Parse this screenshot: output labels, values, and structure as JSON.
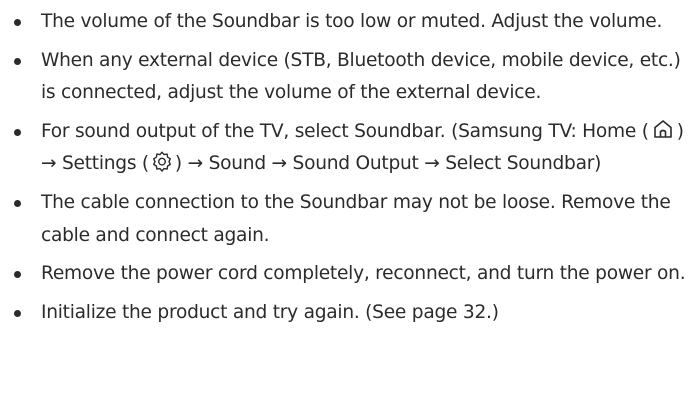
{
  "tips": [
    {
      "text": "The volume of the Soundbar is too low or muted. Adjust the volume."
    },
    {
      "text": "When any external device (STB, Bluetooth device, mobile device, etc.) is connected, adjust the volume of the external device."
    },
    {
      "part1": "For sound output of the TV, select Soundbar. (Samsung TV: Home (",
      "icon1": "home-icon",
      "part2": ") → Settings (",
      "icon2": "gear-icon",
      "part3": ") → Sound → Sound Output → Select Soundbar)"
    },
    {
      "text": "The cable connection to the Soundbar may not be loose. Remove the cable and connect again."
    },
    {
      "text": "Remove the power cord completely, reconnect, and turn the power on."
    },
    {
      "text": "Initialize the product and try again. (See page 32.)"
    }
  ]
}
